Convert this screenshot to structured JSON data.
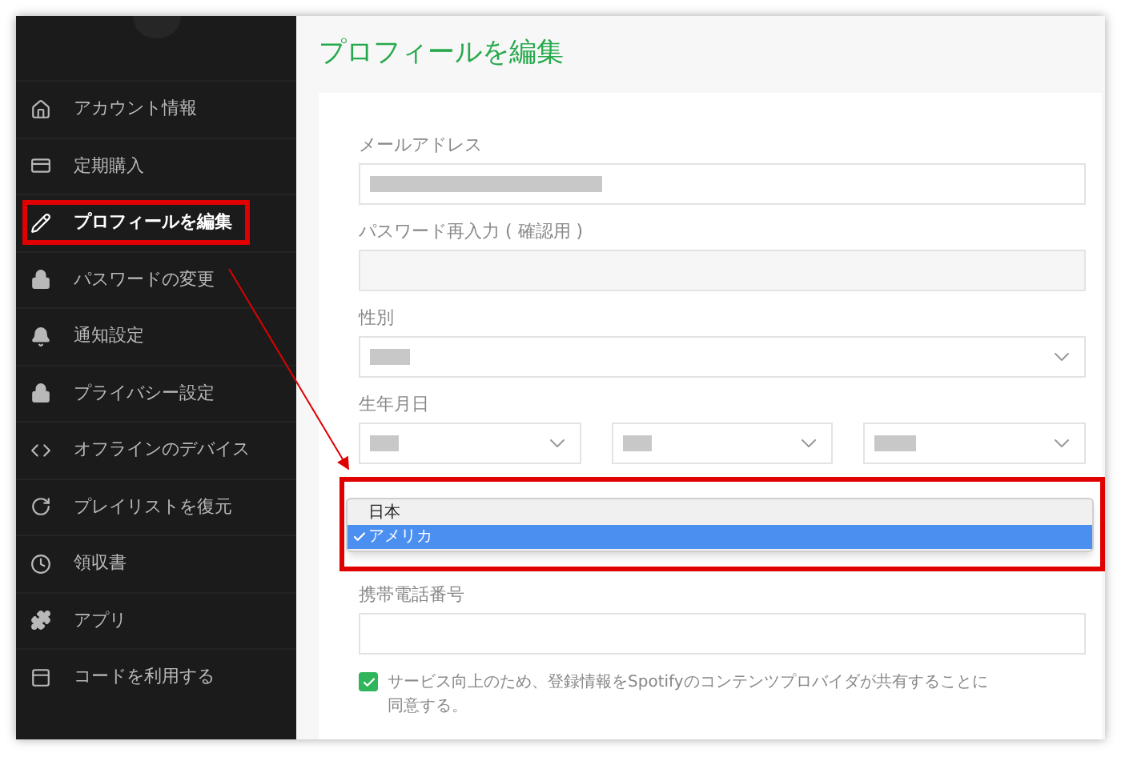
{
  "sidebar": {
    "items": [
      {
        "label": "アカウント情報",
        "selected": false
      },
      {
        "label": "定期購入",
        "selected": false
      },
      {
        "label": "プロフィールを編集",
        "selected": true
      },
      {
        "label": "パスワードの変更",
        "selected": false
      },
      {
        "label": "通知設定",
        "selected": false
      },
      {
        "label": "プライバシー設定",
        "selected": false
      },
      {
        "label": "オフラインのデバイス",
        "selected": false
      },
      {
        "label": "プレイリストを復元",
        "selected": false
      },
      {
        "label": "領収書",
        "selected": false
      },
      {
        "label": "アプリ",
        "selected": false
      },
      {
        "label": "コードを利用する",
        "selected": false
      }
    ]
  },
  "page": {
    "title": "プロフィールを編集"
  },
  "form": {
    "fields": [
      {
        "kind": "text",
        "label": "メールアドレス",
        "redacted": true
      },
      {
        "kind": "text",
        "label": "パスワード再入力 ( 確認用 )",
        "redacted": false
      },
      {
        "kind": "select",
        "label": "性別",
        "redacted": true
      },
      {
        "kind": "date",
        "label": "生年月日",
        "redacted": true
      },
      {
        "kind": "dropdown",
        "options": [
          {
            "label": "日本",
            "selected": false
          },
          {
            "label": "アメリカ",
            "selected": true
          }
        ]
      },
      {
        "kind": "text",
        "label": "携帯電話番号",
        "redacted": false
      }
    ],
    "consent": {
      "checked": true,
      "text": "サービス向上のため、登録情報をSpotifyのコンテンツプロバイダが共有することに同意する。"
    }
  }
}
